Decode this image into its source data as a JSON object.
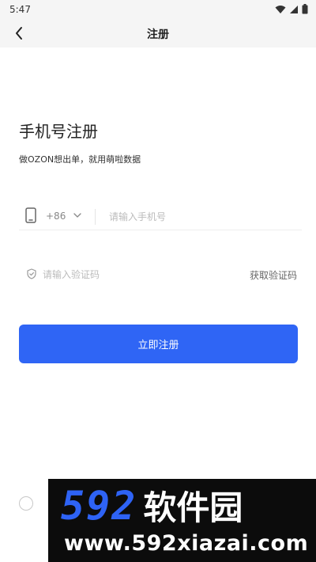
{
  "status_bar": {
    "time": "5:47"
  },
  "nav": {
    "title": "注册"
  },
  "main": {
    "heading": "手机号注册",
    "subheading": "做OZON想出单，就用萌啦数据"
  },
  "phone": {
    "country_code": "+86",
    "placeholder": "请输入手机号",
    "value": ""
  },
  "code": {
    "placeholder": "请输入验证码",
    "value": "",
    "get_code_label": "获取验证码"
  },
  "register_button": {
    "label": "立即注册"
  },
  "watermark": {
    "number": "592",
    "chinese": "软件园",
    "url": "www.592xiazai.com"
  },
  "colors": {
    "accent": "#2f65f5",
    "watermark_bg": "#0c0c0c",
    "watermark_number": "#2e63f5"
  }
}
